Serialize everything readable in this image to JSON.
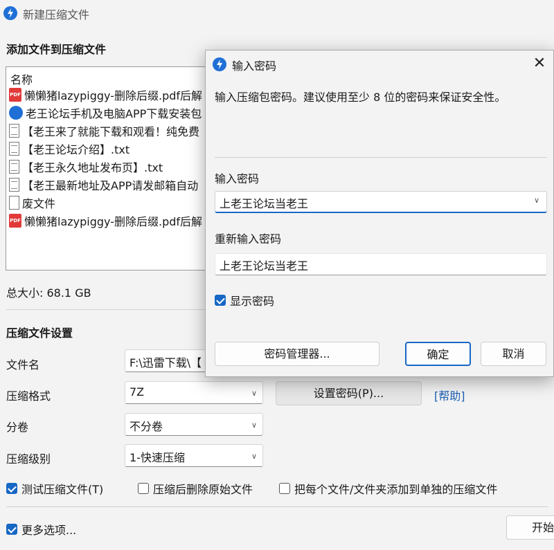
{
  "main": {
    "title": "新建压缩文件",
    "add_section": "添加文件到压缩文件",
    "list_header": "名称",
    "files": [
      {
        "name": "懒懒猪lazypiggy-删除后缀.pdf后解",
        "icon": "pdf-icon"
      },
      {
        "name": "老王论坛手机及电脑APP下载安装包",
        "icon": "app-icon"
      },
      {
        "name": "【老王来了就能下载和观看！纯免费",
        "icon": "txt-icon"
      },
      {
        "name": "【老王论坛介绍】.txt",
        "icon": "txt-icon"
      },
      {
        "name": "【老王永久地址发布页】.txt",
        "icon": "txt-icon"
      },
      {
        "name": "【老王最新地址及APP请发邮箱自动",
        "icon": "txt-icon"
      },
      {
        "name": "废文件",
        "icon": "blank-file-icon"
      },
      {
        "name": "懒懒猪lazypiggy-删除后缀.pdf后解",
        "icon": "pdf-icon"
      }
    ],
    "total_size": "总大小: 68.1 GB",
    "settings_section": "压缩文件设置",
    "filename_label": "文件名",
    "filename_value": "F:\\迅雷下载\\【",
    "format_label": "压缩格式",
    "format_value": "7Z",
    "set_password_button": "设置密码(P)...",
    "help_link": "[帮助]",
    "split_label": "分卷",
    "split_value": "不分卷",
    "level_label": "压缩级别",
    "level_value": "1-快速压缩",
    "test_checkbox": "测试压缩文件(T)",
    "delete_checkbox": "压缩后删除原始文件",
    "separate_checkbox": "把每个文件/文件夹添加到单独的压缩文件",
    "more_options": "更多选项...",
    "start_button": "开始"
  },
  "dialog": {
    "title": "输入密码",
    "description": "输入压缩包密码。建议使用至少 8 位的密码来保证安全性。",
    "password_label": "输入密码",
    "password_value": "上老王论坛当老王",
    "reenter_label": "重新输入密码",
    "reenter_value": "上老王论坛当老王",
    "show_password": "显示密码",
    "manager_button": "密码管理器...",
    "ok_button": "确定",
    "cancel_button": "取消"
  },
  "state": {
    "test_checked": true,
    "delete_checked": false,
    "separate_checked": false,
    "more_checked": true,
    "show_password_checked": true
  },
  "colors": {
    "accent": "#1767c4",
    "link": "#1a5fb4",
    "pdf": "#e13a3a"
  }
}
